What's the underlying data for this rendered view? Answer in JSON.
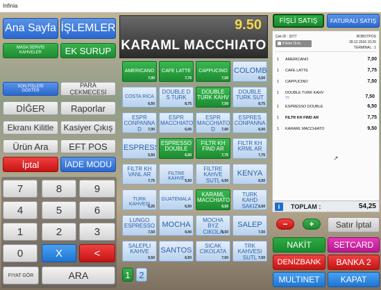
{
  "window": {
    "title": "Infinia"
  },
  "left_panel": {
    "ana_sayfa": "Ana Sayfa",
    "islemler": "İŞLEMLER",
    "masa_servis": "MASA SERVİS KAHVELER",
    "ek_surup": "EK SURUP",
    "son_fisleri": "SON FİŞLERİ GÖSTER",
    "para_cekmecesi": "PARA ÇEKMECESİ",
    "diger": "DİĞER",
    "raporlar": "Raporlar",
    "ekrani_kilitle": "Ekranı Kilitle",
    "kasiyer_cikis": "Kasiyer Çıkış",
    "urun_ara": "Ürün Ara",
    "eft_pos": "EFT POS",
    "iptal": "İptal",
    "iade_modu": "İADE MODU"
  },
  "numpad": {
    "keys": [
      "7",
      "8",
      "9",
      "4",
      "5",
      "6",
      "1",
      "2",
      "3",
      "0"
    ],
    "clear": "X",
    "back": "<",
    "fiyat_gor": "FIYAT GÖR",
    "ara": "ARA"
  },
  "banner": {
    "price": "9.50",
    "product": "KARAML MACCHIATO"
  },
  "products": [
    {
      "name": "AMERICANO",
      "price": "7,00",
      "style": "green"
    },
    {
      "name": "CAFE LATTE",
      "price": "7,75",
      "style": "green"
    },
    {
      "name": "CAPPUCINO",
      "price": "7,50",
      "style": "green"
    },
    {
      "name": "COLOMBIA",
      "price": "6,50",
      "style": "light"
    },
    {
      "name": "COSTA RICA",
      "price": "6,50",
      "style": "light"
    },
    {
      "name": "DOUBLE D S TURK",
      "price": "8,75",
      "style": "light"
    },
    {
      "name": "DOUBLE TURK KAHV",
      "price": "7,50",
      "style": "green"
    },
    {
      "name": "DOUBLE TURK SUT",
      "price": "8,75",
      "style": "light"
    },
    {
      "name": "ESPR CONPANNA D",
      "price": "7,00",
      "style": "light"
    },
    {
      "name": "ESPR MACCHIATO",
      "price": "6,00",
      "style": "light"
    },
    {
      "name": "ESPR MACCHIATO D",
      "price": "7,00",
      "style": "light"
    },
    {
      "name": "ESPRES CONPANNA",
      "price": "6,00",
      "style": "light"
    },
    {
      "name": "ESPRESSO",
      "price": "5,50",
      "style": "light"
    },
    {
      "name": "ESPRESSO DOUBLE",
      "price": "6,50",
      "style": "green"
    },
    {
      "name": "FILTR KH FIND AR",
      "price": "7,75",
      "style": "green"
    },
    {
      "name": "FILTR KH KRML AR",
      "price": "7,75",
      "style": "light"
    },
    {
      "name": "FILTR KH VANL AR",
      "price": "7,75",
      "style": "light"
    },
    {
      "name": "FILTRE KAHVE",
      "price": "5,50",
      "style": "light"
    },
    {
      "name": "FILTRE KAHVE SUTL",
      "price": "6,50",
      "style": "light"
    },
    {
      "name": "KENYA",
      "price": "6,50",
      "style": "light"
    },
    {
      "name": "TURK KAHVESI",
      "price": "6,25",
      "style": "light"
    },
    {
      "name": "GUATEMALA",
      "price": "6,50",
      "style": "light"
    },
    {
      "name": "KARAML MACCHIATO",
      "price": "9,50",
      "style": "green"
    },
    {
      "name": "TURK KAHD SAKIZ",
      "price": "6,50",
      "style": "light"
    },
    {
      "name": "LUNGO ESPRESSO",
      "price": "7,50",
      "style": "light"
    },
    {
      "name": "MOCHA",
      "price": "9,00",
      "style": "light"
    },
    {
      "name": "MOCHA BYZ CIKOLA",
      "price": "9,50",
      "style": "light"
    },
    {
      "name": "SALEP",
      "price": "7,50",
      "style": "light"
    },
    {
      "name": "SALEPLI KAHVE",
      "price": "9,50",
      "style": "light"
    },
    {
      "name": "SANTOS",
      "price": "6,50",
      "style": "light"
    },
    {
      "name": "SICAK CIKOLATA",
      "price": "7,50",
      "style": "light"
    },
    {
      "name": "TRK KAHVESI SUTL",
      "price": "7,50",
      "style": "light"
    }
  ],
  "pages": [
    "1",
    "2"
  ],
  "sale_type": {
    "fisli": "FİŞLİ SATIŞ",
    "faturali": "FATURALI SATIŞ"
  },
  "receipt": {
    "cek_id": "Çek ID : 3277",
    "shop": "ROBOTPOS",
    "date": "28.12.2016 10:25",
    "terminal": "TERMINAL : 1",
    "count_tag": "8 Adet Ürün",
    "items": [
      {
        "qty": "1",
        "name": "AMERICANO",
        "price": "7,00",
        "bold": false,
        "extra": ""
      },
      {
        "qty": "1",
        "name": "CAFE LATTE",
        "price": "7,75",
        "bold": false,
        "extra": ""
      },
      {
        "qty": "1",
        "name": "CAPPUCINO",
        "price": "7,50",
        "bold": false,
        "extra": ""
      },
      {
        "qty": "1",
        "name": "DOUBLE TURK KAHV",
        "price": "",
        "bold": false,
        "extra": "??"
      },
      {
        "qty": "1",
        "name": "ESPRESSO DOUBLE",
        "price": "6,50",
        "bold": false,
        "extra": ""
      },
      {
        "qty": "1",
        "name": "FILTR KH FIND AR",
        "price": "7,75",
        "bold": true,
        "extra": ""
      },
      {
        "qty": "1",
        "name": "KARAML MACCHIATO",
        "price": "9,50",
        "bold": false,
        "extra": ""
      }
    ],
    "double_price": "7,50",
    "total_label": "TOPLAM :",
    "total_value": "54,25"
  },
  "actions": {
    "minus": "−",
    "plus": "+",
    "satir_iptal": "Satır İptal",
    "nakit": "NAKİT",
    "setcard": "SETCARD",
    "denizbank": "DENİZBANK",
    "banka2": "BANKA 2",
    "multinet": "MULTINET",
    "kapat": "KAPAT"
  },
  "colors": {
    "accent_blue": "#2a68d0",
    "accent_green": "#1e8a32",
    "accent_red": "#c41414",
    "accent_magenta": "#b71990",
    "banner_price": "#f2d84a"
  }
}
